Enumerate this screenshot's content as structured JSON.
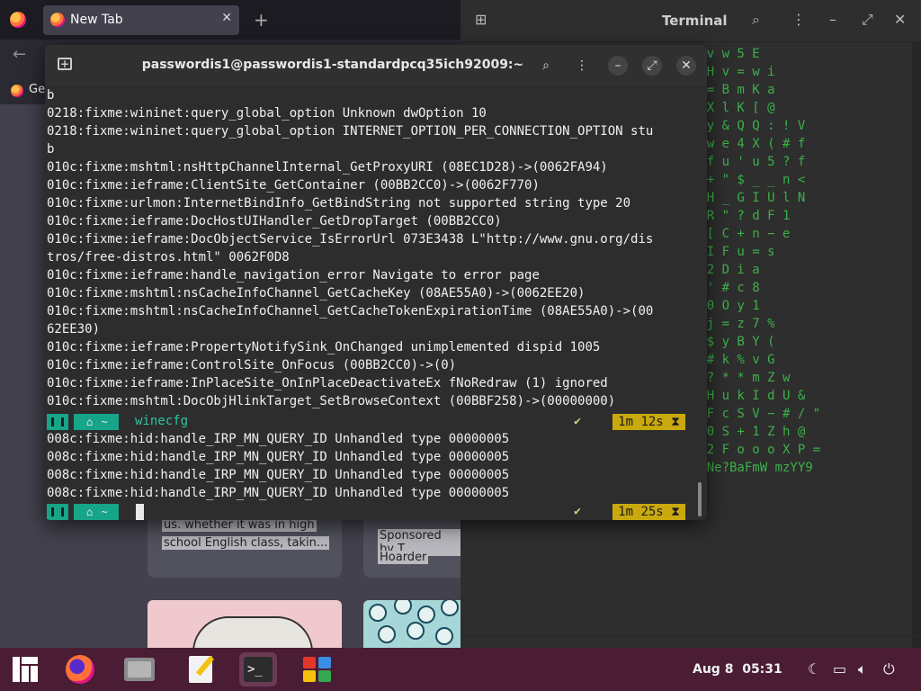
{
  "browser": {
    "tab_title": "New Tab",
    "tab_close": "✕",
    "new_tab": "+",
    "back": "←",
    "bookmark_label": "Ge",
    "card1_line1": "us. whether it was in high",
    "card1_line2": "school English class, takin...",
    "card2_line1": "Sponsored by T",
    "card2_line2": "Hoarder"
  },
  "bg_terminal": {
    "title": "Terminal",
    "matrix_rows": [
      "G  =  v w  5 E",
      "b y   H v = w  i",
      "x 6   = B m K  a",
      "[ v   X l K [  @",
      "i &  y & Q Q : ! V",
      "( $  w e 4 X ( # f",
      "$ H  f u ' u 5 ? f",
      "s z  + \" $ _ _ n <",
      "z K  H _ G I U l N",
      "h p  R \" ? d F 1",
      "F e  [ C + n − e",
      "a \"  I F u = s",
      "5   v 2 D i a",
      "o    = ' # c 8",
      "D  d 0  O y 1",
      "^  u j  = z 7  %",
      "w  > $  y B Y  (",
      "4  n #  k % v  G",
      "$  i ? * * m Z  w",
      "Z  ' H u k I d  U &",
      "r  * F c S V − #  / \"",
      "*  z 0 S + 1 Z  h @",
      "J  & 2 F o o o  X P =",
      "4  f<Ne?BaFmW  mzYY9"
    ]
  },
  "terminal": {
    "title": "passwordis1@passwordis1-standardpcq35ich92009:~",
    "lines": [
      "b",
      "0218:fixme:wininet:query_global_option Unknown dwOption 10",
      "0218:fixme:wininet:query_global_option INTERNET_OPTION_PER_CONNECTION_OPTION stu",
      "b",
      "010c:fixme:mshtml:nsHttpChannelInternal_GetProxyURI (08EC1D28)->(0062FA94)",
      "010c:fixme:ieframe:ClientSite_GetContainer (00BB2CC0)->(0062F770)",
      "010c:fixme:urlmon:InternetBindInfo_GetBindString not supported string type 20",
      "010c:fixme:ieframe:DocHostUIHandler_GetDropTarget (00BB2CC0)",
      "010c:fixme:ieframe:DocObjectService_IsErrorUrl 073E3438 L\"http://www.gnu.org/dis",
      "tros/free-distros.html\" 0062F0D8",
      "010c:fixme:ieframe:handle_navigation_error Navigate to error page",
      "010c:fixme:mshtml:nsCacheInfoChannel_GetCacheKey (08AE55A0)->(0062EE20)",
      "010c:fixme:mshtml:nsCacheInfoChannel_GetCacheTokenExpirationTime (08AE55A0)->(00",
      "62EE30)",
      "010c:fixme:ieframe:PropertyNotifySink_OnChanged unimplemented dispid 1005",
      "010c:fixme:ieframe:ControlSite_OnFocus (00BB2CC0)->(0)",
      "010c:fixme:ieframe:InPlaceSite_OnInPlaceDeactivateEx fNoRedraw (1) ignored",
      "010c:fixme:mshtml:DocObjHlinkTarget_SetBrowseContext (00BBF258)->(00000000)"
    ],
    "prompt1": {
      "home": "~",
      "command": "winecfg",
      "status": "✔",
      "duration": "1m 12s ⧗"
    },
    "lines2": [
      "008c:fixme:hid:handle_IRP_MN_QUERY_ID Unhandled type 00000005",
      "008c:fixme:hid:handle_IRP_MN_QUERY_ID Unhandled type 00000005",
      "008c:fixme:hid:handle_IRP_MN_QUERY_ID Unhandled type 00000005",
      "008c:fixme:hid:handle_IRP_MN_QUERY_ID Unhandled type 00000005"
    ],
    "prompt2": {
      "home": "~",
      "status": "✔",
      "duration": "1m 25s ⧗"
    }
  },
  "taskbar": {
    "date": "Aug 8",
    "time": "05:31"
  },
  "icons": [
    "search-icon",
    "menu-icon",
    "minimize-icon",
    "maximize-icon",
    "close-icon",
    "new-tab-icon",
    "home-icon",
    "manjaro-logo-icon",
    "firefox-icon",
    "files-icon",
    "text-editor-icon",
    "terminal-icon",
    "software-icon",
    "night-mode-icon",
    "display-icon",
    "volume-icon",
    "power-icon"
  ],
  "colors": {
    "taskbar": "#4a1d35",
    "prompt_teal": "#17a589",
    "duration_yellow": "#c9a90d",
    "matrix_green": "#3bb14a"
  }
}
